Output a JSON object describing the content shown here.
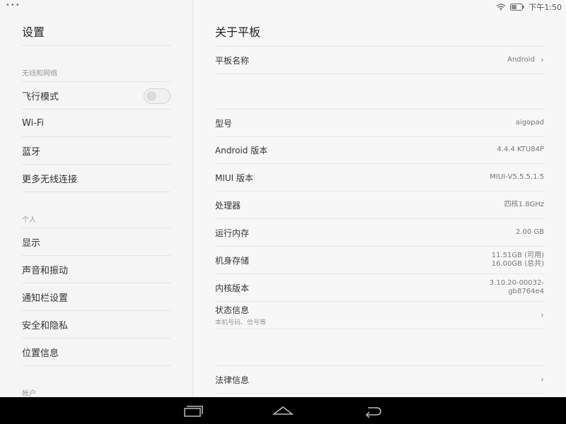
{
  "sidebar": {
    "title": "设置",
    "sections": {
      "wireless": "无线和网络",
      "personal": "个人",
      "account": "帐户"
    },
    "items": {
      "airplane": "飞行模式",
      "wifi": "Wi‑Fi",
      "bluetooth": "蓝牙",
      "more_wireless": "更多无线连接",
      "display": "显示",
      "sound": "声音和振动",
      "notification": "通知栏设置",
      "security": "安全和隐私",
      "location": "位置信息"
    },
    "airplane_mode_on": false
  },
  "status_bar": {
    "time": "下午1:50"
  },
  "main": {
    "title": "关于平板",
    "rows": {
      "device_name": {
        "label": "平板名称",
        "value": "Android"
      },
      "model": {
        "label": "型号",
        "value": "aigopad"
      },
      "android_version": {
        "label": "Android 版本",
        "value": "4.4.4 KTU84P"
      },
      "miui_version": {
        "label": "MIUI 版本",
        "value": "MIUI‑V5.5.5.1.5"
      },
      "processor": {
        "label": "处理器",
        "value": "四核1.8GHz"
      },
      "ram": {
        "label": "运行内存",
        "value": "2.00 GB"
      },
      "storage": {
        "label": "机身存储",
        "value_line1": "11.51GB (可用)",
        "value_line2": "16.00GB (总共)"
      },
      "kernel": {
        "label": "内核版本",
        "value_line1": "3.10.20‑00032‑",
        "value_line2": "gb8764e4"
      },
      "status_info": {
        "label": "状态信息",
        "sub": "本机号码、信号等"
      },
      "legal": {
        "label": "法律信息"
      }
    }
  }
}
